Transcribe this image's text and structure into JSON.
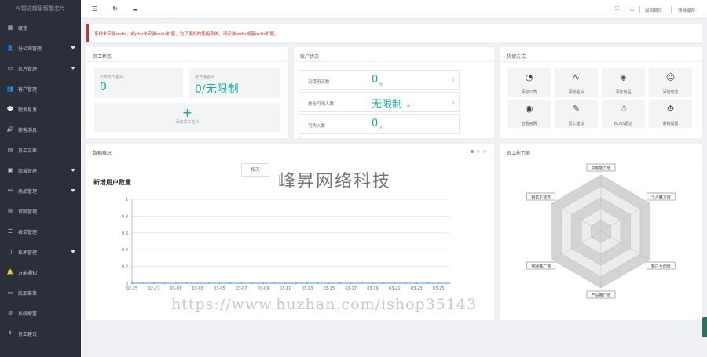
{
  "app": {
    "brand": "AI雷达超级智能名片"
  },
  "sidebar": {
    "items": [
      {
        "icon": "grid-icon",
        "glyph": "▦",
        "label": "概览",
        "arrow": false
      },
      {
        "icon": "user-icon",
        "glyph": "👤",
        "label": "分公司管理",
        "arrow": true
      },
      {
        "icon": "card-icon",
        "glyph": "▭",
        "label": "名片管理",
        "arrow": true
      },
      {
        "icon": "users-icon",
        "glyph": "👥",
        "label": "客户管理",
        "arrow": false
      },
      {
        "icon": "chat-icon",
        "glyph": "💬",
        "label": "短消息发",
        "arrow": false
      },
      {
        "icon": "volume-icon",
        "glyph": "🔊",
        "label": "获客消息",
        "arrow": false
      },
      {
        "icon": "doc-icon",
        "glyph": "▤",
        "label": "员工文章",
        "arrow": false
      },
      {
        "icon": "shop-icon",
        "glyph": "▣",
        "label": "商城管理",
        "arrow": true
      },
      {
        "icon": "link-icon",
        "glyph": "⚯",
        "label": "商品管理",
        "arrow": true
      },
      {
        "icon": "globe-icon",
        "glyph": "◍",
        "label": "官网管理",
        "arrow": false
      },
      {
        "icon": "form-icon",
        "glyph": "☰",
        "label": "表单管理",
        "arrow": false
      },
      {
        "icon": "code-icon",
        "glyph": "⟨⟩",
        "label": "技术管理",
        "arrow": true
      },
      {
        "icon": "bell-icon",
        "glyph": "🔔",
        "label": "万能通知",
        "arrow": false
      },
      {
        "icon": "monitor-icon",
        "glyph": "▭",
        "label": "底部菜单",
        "arrow": false
      },
      {
        "icon": "gear-icon",
        "glyph": "⚙",
        "label": "系统配置",
        "arrow": false
      },
      {
        "icon": "sitemap-icon",
        "glyph": "⚘",
        "label": "员工建议",
        "arrow": false
      }
    ]
  },
  "topbar": {
    "left_glyphs": [
      "☰",
      "↻",
      "▬"
    ],
    "right": {
      "fullscreen_glyph": "⛶",
      "msg_glyph": "▭",
      "back": "返回首页",
      "clear": "清除缓存"
    }
  },
  "alert": {
    "text": "系统未安装redis，或php未安装redis扩展，为了更好的使用系统，请安装redis或者redis扩展。"
  },
  "staff_panel": {
    "title": "员工状态",
    "stat1": {
      "label": "已开员工名片",
      "value": "0"
    },
    "stat2": {
      "label": "可开通名片",
      "value": "0/无限制"
    },
    "add_label": "添加员工名片"
  },
  "account_panel": {
    "title": "账户状态",
    "rows": [
      {
        "label": "已使用天数",
        "value": "0",
        "unit": "天",
        "num": "0"
      },
      {
        "label": "剩余可用人数",
        "value": "无限制",
        "unit": "天",
        "num": "0"
      },
      {
        "label": "可购入数",
        "value": "0",
        "unit": "人",
        "num": ""
      }
    ]
  },
  "quick_panel": {
    "title": "快捷方式",
    "tiles": [
      {
        "icon": "dashboard-icon",
        "glyph": "◔",
        "label": "添加公司"
      },
      {
        "icon": "pulse-icon",
        "glyph": "∿",
        "label": "添加名片"
      },
      {
        "icon": "layers-icon",
        "glyph": "◈",
        "label": "添加商品"
      },
      {
        "icon": "smile-icon",
        "glyph": "☺",
        "label": "添加动态"
      },
      {
        "icon": "compass-icon",
        "glyph": "◉",
        "label": "查看官网"
      },
      {
        "icon": "edit-icon",
        "glyph": "✎",
        "label": "员工建议"
      },
      {
        "icon": "boss-icon",
        "glyph": "☃",
        "label": "BOSS雷达"
      },
      {
        "icon": "settings-icon",
        "glyph": "⚙",
        "label": "系统设置"
      }
    ]
  },
  "trend_panel": {
    "title": "数据概况",
    "tab": "按天"
  },
  "ability_panel": {
    "title": "员工能力值"
  },
  "watermark": {
    "text": "峰昇网络科技",
    "url": "https://www.huzhan.com/ishop35143"
  },
  "chart_data": [
    {
      "type": "line",
      "title": "新增用户数量",
      "x": [
        "02-25",
        "02-26",
        "02-27",
        "02-28",
        "03-01",
        "03-02",
        "03-03",
        "03-04",
        "03-05",
        "03-06",
        "03-07",
        "03-08",
        "03-09",
        "03-10",
        "03-11",
        "03-12",
        "03-13",
        "03-14",
        "03-15",
        "03-16",
        "03-17",
        "03-18",
        "03-19",
        "03-20",
        "03-21",
        "03-22",
        "03-23",
        "03-24",
        "03-25",
        "03-26"
      ],
      "xtick_labels": [
        "02-25",
        "02-27",
        "03-01",
        "03-03",
        "03-05",
        "03-07",
        "03-09",
        "03-11",
        "03-13",
        "03-15",
        "03-17",
        "03-19",
        "03-21",
        "03-23",
        "03-25"
      ],
      "series": [
        {
          "values": [
            0,
            0,
            0,
            0,
            0,
            0,
            0,
            0,
            0,
            0,
            0,
            0,
            0,
            0,
            0,
            0,
            0,
            0,
            0,
            0,
            0,
            0,
            0,
            0,
            0,
            0,
            0,
            0,
            0,
            0
          ]
        }
      ],
      "ylim": [
        0,
        1
      ],
      "yticks": [
        "0",
        "0.2",
        "0.4",
        "0.6",
        "0.8",
        "1"
      ],
      "grid": true,
      "colors": {
        "line": "#5fb3d8",
        "grid": "#dcdcdc"
      }
    },
    {
      "type": "radar",
      "indicators": [
        "获客能力值",
        "个人魅力值",
        "客户互动值",
        "产品推广值",
        "官网推广值",
        "销售主动性"
      ],
      "series": [
        {
          "values": [
            0,
            0,
            0,
            0,
            0,
            0
          ]
        }
      ],
      "colors": {
        "ring_dark": "#d4d4d4",
        "ring_light": "#ececec"
      }
    }
  ]
}
